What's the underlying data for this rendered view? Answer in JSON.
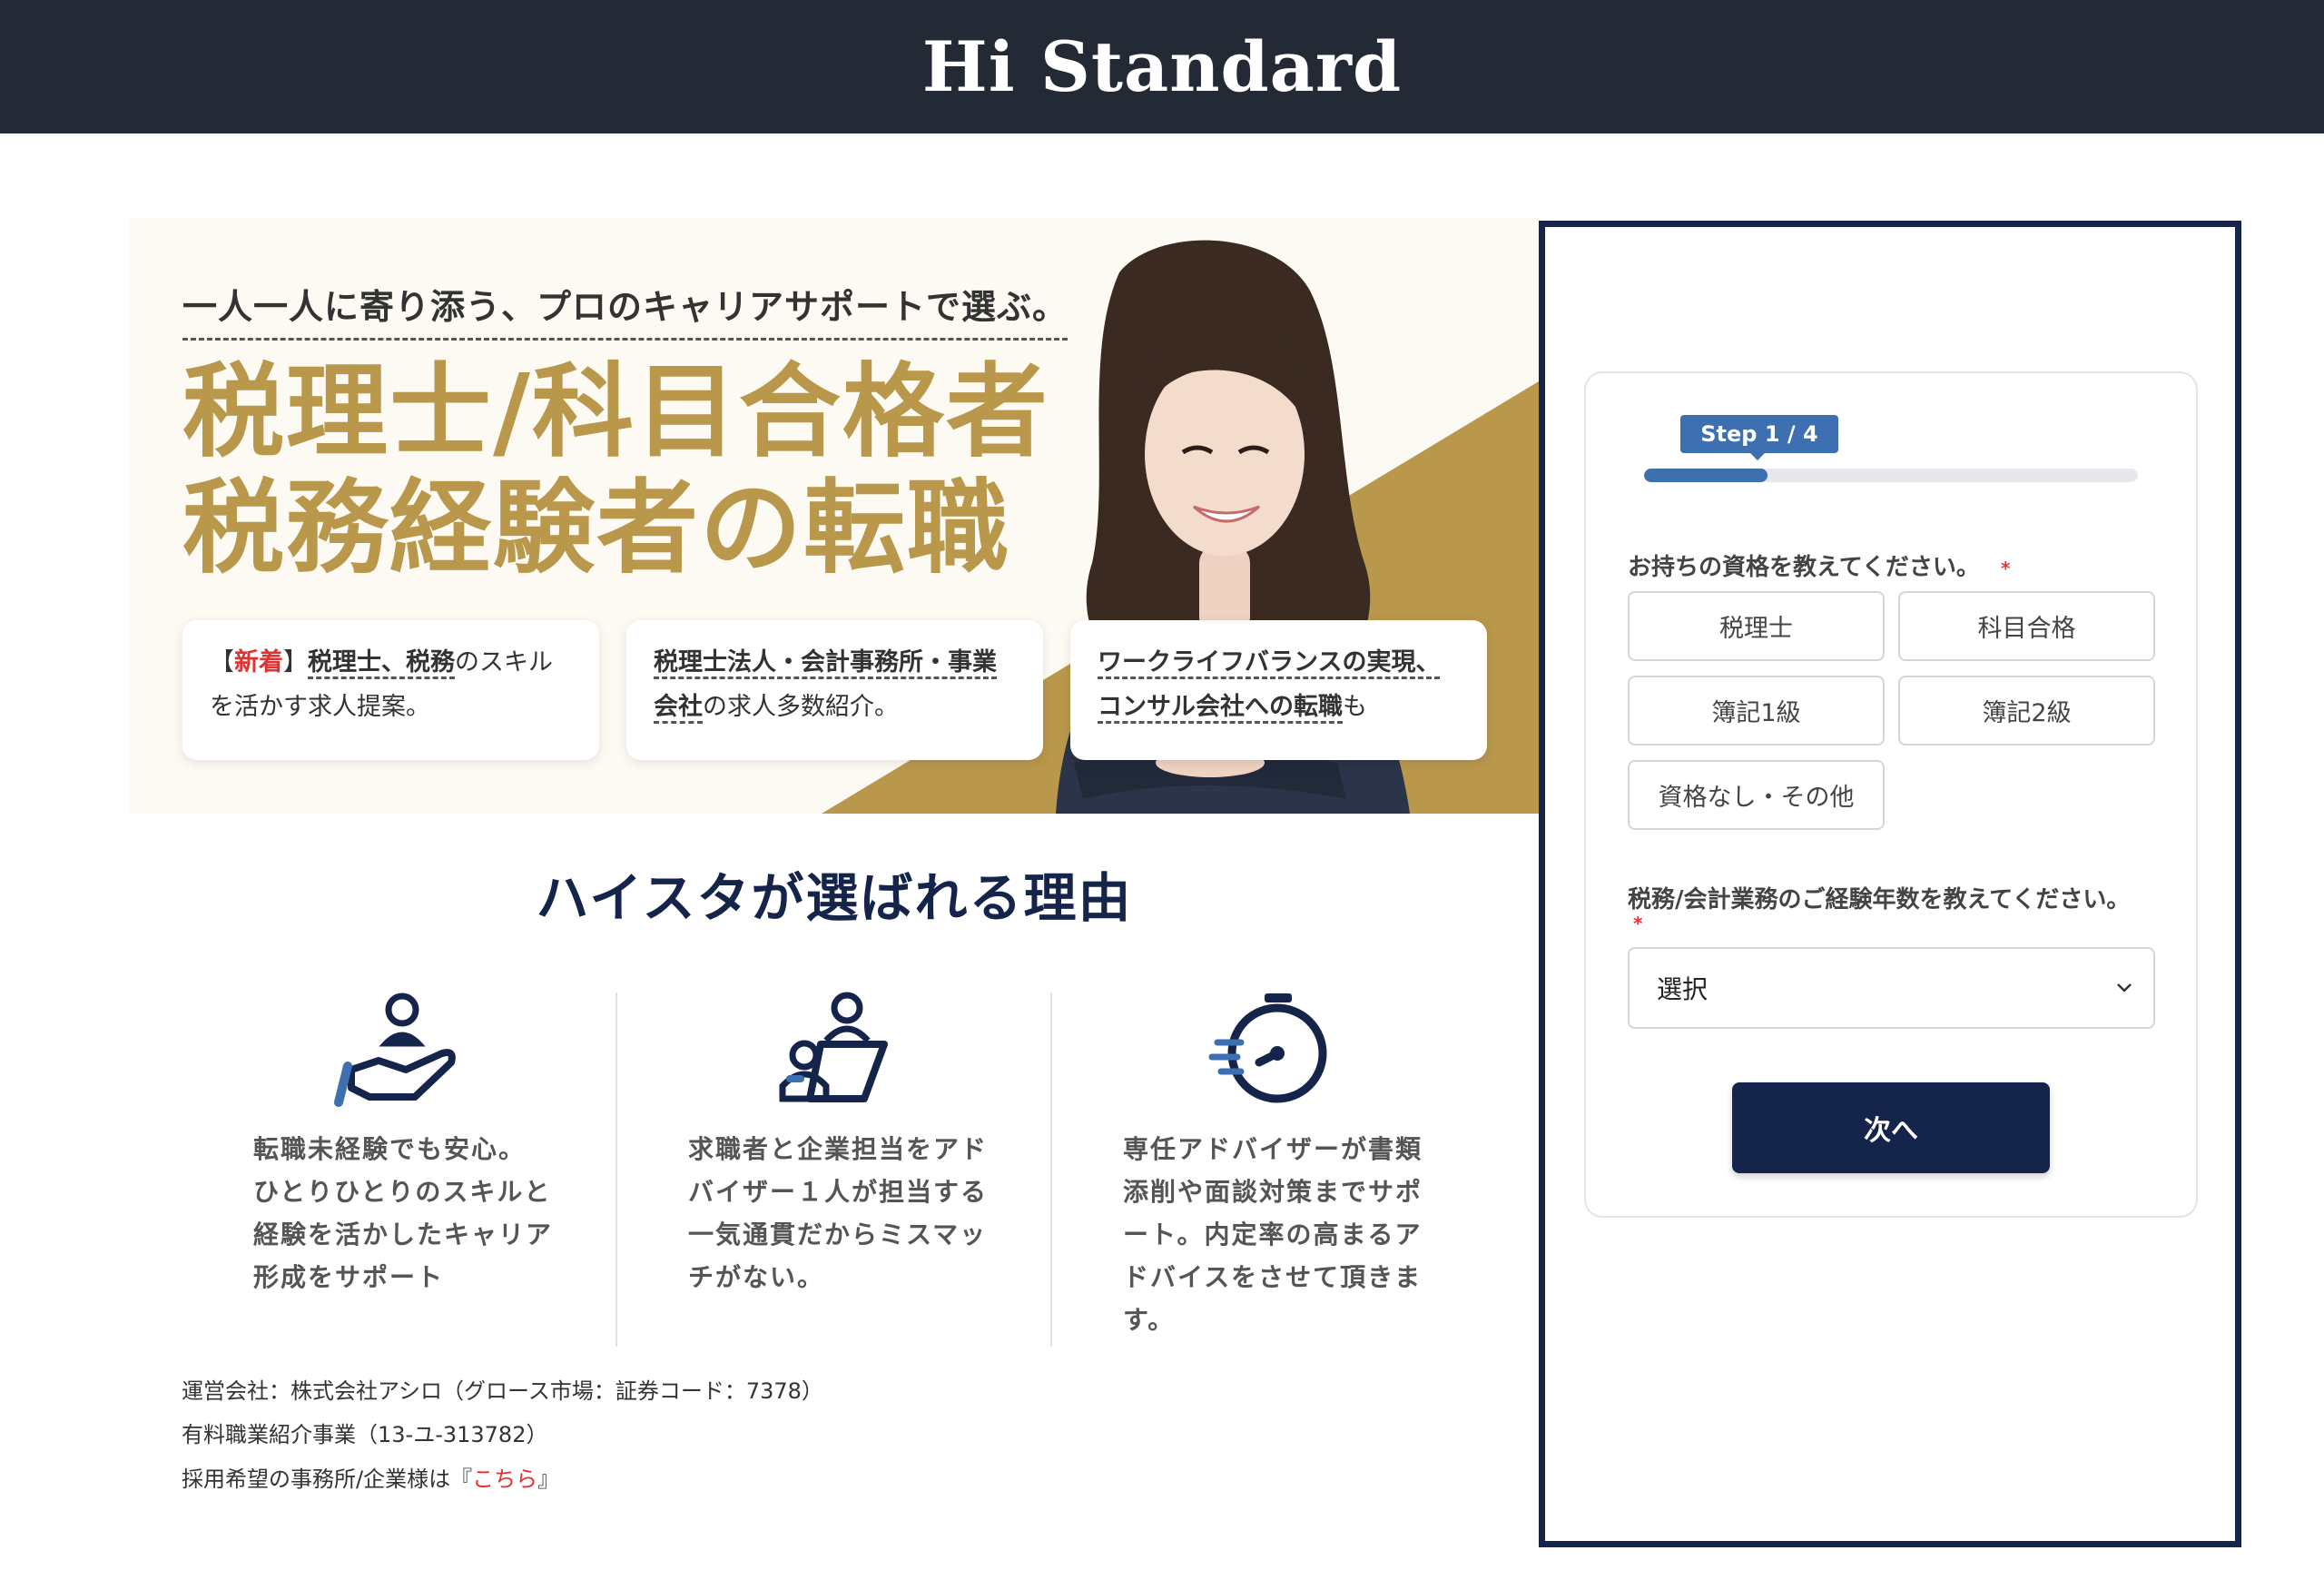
{
  "header": {
    "logo": "Hi Standard"
  },
  "hero": {
    "lead": "一人一人に寄り添う、プロのキャリアサポートで選ぶ。",
    "title_line1": "税理士/科目合格者",
    "title_line2": "税務経験者の転職",
    "cards": [
      {
        "pre_bracket_open": "【",
        "new": "新着",
        "pre_bracket_close": "】",
        "u1": "税理士、税務",
        "rest1": "のスキル",
        "line2": "を活かす求人提案。"
      },
      {
        "u1": "税理士法人・会計事務所・事業",
        "u2": "会社",
        "rest2": "の求人多数紹介。"
      },
      {
        "u1": "ワークライフバランスの実現、",
        "u2": "コンサル会社への転職",
        "rest2": "も"
      }
    ]
  },
  "reasons": {
    "title": "ハイスタが選ばれる理由",
    "items": [
      {
        "icon": "hand-person-icon",
        "text": "転職未経験でも安心。ひとりひとりのスキルと経験を活かしたキャリア形成をサポート"
      },
      {
        "icon": "advisor-meeting-icon",
        "text": "求職者と企業担当をアドバイザー１人が担当する一気通貫だからミスマッチがない。"
      },
      {
        "icon": "stopwatch-icon",
        "text": "専任アドバイザーが書類添削や面談対策までサポート。内定率の高まるアドバイスをさせて頂きます。"
      }
    ]
  },
  "footer": {
    "company": "運営会社：株式会社アシロ（グロース市場：証券コード：7378）",
    "license": "有料職業紹介事業（13-ユ-313782）",
    "recruit_prefix": "採用希望の事務所/企業様は『",
    "recruit_link": "こちら",
    "recruit_suffix": "』"
  },
  "form": {
    "step_label": "Step 1 / 4",
    "progress": 0.25,
    "q1": {
      "label": "お持ちの資格を教えてください。",
      "required_mark": "*"
    },
    "q1_options": [
      "税理士",
      "科目合格",
      "簿記1級",
      "簿記2級",
      "資格なし・その他"
    ],
    "q2": {
      "label": "税務/会計業務のご経験年数を教えてください。",
      "required_mark": "*"
    },
    "select_value": "選択",
    "next_label": "次へ"
  },
  "colors": {
    "navy": "#15244a",
    "gold": "#b9974b",
    "blue": "#3d6fb1",
    "header": "#232a36"
  }
}
